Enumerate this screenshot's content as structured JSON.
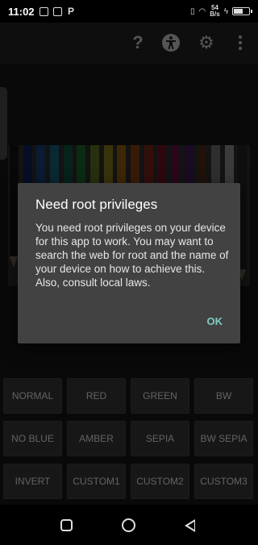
{
  "status_bar": {
    "time": "11:02",
    "net_speed_value": "54",
    "net_speed_unit": "B/s",
    "p_icon_label": "P"
  },
  "toolbar": {
    "help_icon": "?",
    "icons": [
      "help-icon",
      "accessibility-icon",
      "settings-icon",
      "more-icon"
    ]
  },
  "preview": {
    "pencil_colors": [
      "#222222",
      "#1b3b9a",
      "#2d6fd1",
      "#2aa3d4",
      "#1c8c6a",
      "#2fb24a",
      "#9ac43c",
      "#e3cf2a",
      "#f2a01c",
      "#e56a1e",
      "#d63a2a",
      "#c21e3b",
      "#a31e6b",
      "#6b2a8f",
      "#7a4a2a",
      "#bbbbbb",
      "#f0f0f0",
      "#3c3c3c"
    ]
  },
  "filters": {
    "row1": [
      "NORMAL",
      "RED",
      "GREEN",
      "BW"
    ],
    "row2": [
      "NO BLUE",
      "AMBER",
      "SEPIA",
      "BW SEPIA"
    ],
    "row3": [
      "INVERT",
      "CUSTOM1",
      "CUSTOM2",
      "CUSTOM3"
    ]
  },
  "dialog": {
    "title": "Need root privileges",
    "message": "You need root privileges on your device for this app to work. You may want to search the web for root and the name of your device on how to achieve this. Also, consult local laws.",
    "ok_label": "OK"
  },
  "navbar": {
    "icons": [
      "recent-apps-icon",
      "home-icon",
      "back-icon"
    ]
  }
}
